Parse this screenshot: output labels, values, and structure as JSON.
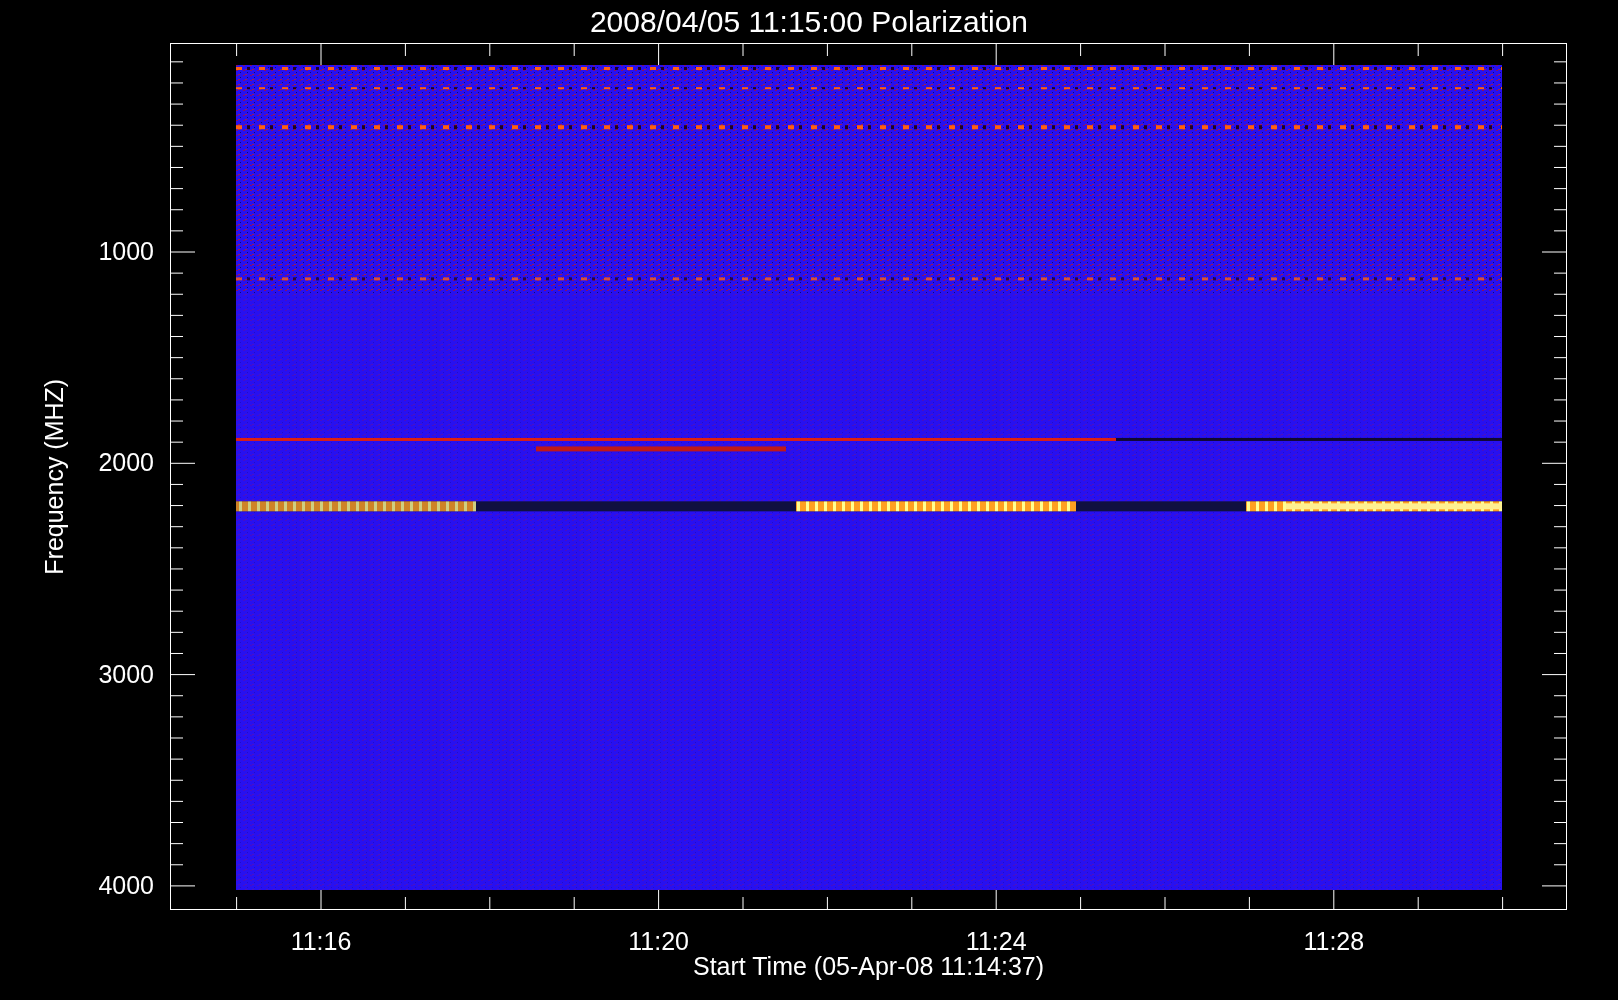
{
  "title": "2008/04/05 11:15:00 Polarization",
  "y_axis": {
    "label": "Frequency (MHZ)",
    "ticks": [
      "1000",
      "2000",
      "3000",
      "4000"
    ]
  },
  "x_axis": {
    "label": "Start Time (05-Apr-08 11:14:37)",
    "ticks": [
      "11:16",
      "11:20",
      "11:24",
      "11:28"
    ]
  }
}
